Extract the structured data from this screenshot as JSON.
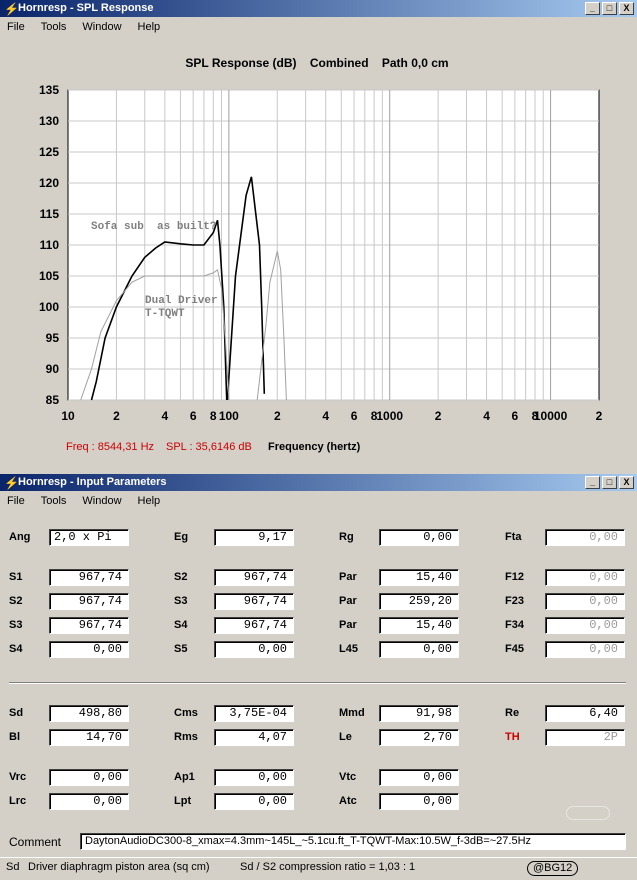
{
  "spl_window": {
    "title": "Hornresp - SPL Response",
    "menu": [
      "File",
      "Tools",
      "Window",
      "Help"
    ],
    "buttons": {
      "minimize": "_",
      "maximize": "□",
      "close": "X"
    }
  },
  "chart_data": {
    "type": "line",
    "title": "SPL Response (dB)    Combined    Path 0,0 cm",
    "xlabel": "Frequency (hertz)",
    "x_scale": "log",
    "xlim": [
      10,
      20000
    ],
    "ylim": [
      85,
      135
    ],
    "y_ticks": [
      135,
      130,
      125,
      120,
      115,
      110,
      105,
      100,
      95,
      90,
      85
    ],
    "x_tick_labels": [
      {
        "f": 10,
        "t": "10"
      },
      {
        "f": 20,
        "t": "2"
      },
      {
        "f": 40,
        "t": "4"
      },
      {
        "f": 60,
        "t": "6"
      },
      {
        "f": 80,
        "t": "8"
      },
      {
        "f": 100,
        "t": "100"
      },
      {
        "f": 200,
        "t": "2"
      },
      {
        "f": 400,
        "t": "4"
      },
      {
        "f": 600,
        "t": "6"
      },
      {
        "f": 800,
        "t": "8"
      },
      {
        "f": 1000,
        "t": "1000"
      },
      {
        "f": 2000,
        "t": "2"
      },
      {
        "f": 4000,
        "t": "4"
      },
      {
        "f": 6000,
        "t": "6"
      },
      {
        "f": 8000,
        "t": "8"
      },
      {
        "f": 10000,
        "t": "10000"
      },
      {
        "f": 20000,
        "t": "2"
      }
    ],
    "grid": true,
    "annotations": [
      "Sofa sub  as built?",
      "Dual Driver",
      "T-TQWT"
    ],
    "series": [
      {
        "color": "#000000",
        "points": [
          [
            14,
            85
          ],
          [
            15,
            88
          ],
          [
            17,
            95
          ],
          [
            20,
            100
          ],
          [
            25,
            105
          ],
          [
            30,
            108
          ],
          [
            35,
            109.5
          ],
          [
            40,
            110.5
          ],
          [
            50,
            110.2
          ],
          [
            60,
            110
          ],
          [
            70,
            110
          ],
          [
            80,
            112
          ],
          [
            85,
            114
          ],
          [
            88,
            110
          ],
          [
            93,
            100
          ],
          [
            97,
            85
          ]
        ]
      },
      {
        "color": "#000000",
        "points": [
          [
            98,
            85
          ],
          [
            110,
            105
          ],
          [
            128,
            118
          ],
          [
            138,
            121
          ],
          [
            147,
            115
          ],
          [
            155,
            110
          ],
          [
            160,
            100
          ],
          [
            166,
            86
          ]
        ]
      },
      {
        "color": "#a0a0a0",
        "points": [
          [
            12,
            85
          ],
          [
            14,
            90
          ],
          [
            16,
            96
          ],
          [
            20,
            101
          ],
          [
            25,
            104
          ],
          [
            30,
            105
          ],
          [
            40,
            105
          ],
          [
            50,
            105
          ],
          [
            60,
            105
          ],
          [
            70,
            105
          ],
          [
            80,
            105.5
          ],
          [
            85,
            106
          ],
          [
            90,
            103
          ],
          [
            95,
            95
          ],
          [
            100,
            85
          ]
        ]
      },
      {
        "color": "#a0a0a0",
        "points": [
          [
            150,
            85
          ],
          [
            170,
            97
          ],
          [
            180,
            104
          ],
          [
            200,
            109
          ],
          [
            210,
            106
          ],
          [
            220,
            95
          ],
          [
            228,
            85
          ]
        ]
      }
    ]
  },
  "readout": {
    "freq": "Freq : 8544,31 Hz",
    "spl": "SPL : 35,6146 dB",
    "axis_label": "Frequency (hertz)"
  },
  "input_window": {
    "title": "Hornresp - Input Parameters",
    "menu": [
      "File",
      "Tools",
      "Window",
      "Help"
    ],
    "buttons": {
      "minimize": "_",
      "maximize": "□",
      "close": "X"
    },
    "params": {
      "ang": {
        "label": "Ang",
        "value": "2,0 x Pi"
      },
      "eg": {
        "label": "Eg",
        "value": "9,17"
      },
      "rg": {
        "label": "Rg",
        "value": "0,00"
      },
      "fta": {
        "label": "Fta",
        "value": "0,00"
      },
      "s1": {
        "label": "S1",
        "value": "967,74"
      },
      "s2a": {
        "label": "S2",
        "value": "967,74"
      },
      "par1": {
        "label": "Par",
        "value": "15,40"
      },
      "f12": {
        "label": "F12",
        "value": "0,00"
      },
      "s2b": {
        "label": "S2",
        "value": "967,74"
      },
      "s3a": {
        "label": "S3",
        "value": "967,74"
      },
      "par2": {
        "label": "Par",
        "value": "259,20"
      },
      "f23": {
        "label": "F23",
        "value": "0,00"
      },
      "s3b": {
        "label": "S3",
        "value": "967,74"
      },
      "s4a": {
        "label": "S4",
        "value": "967,74"
      },
      "par3": {
        "label": "Par",
        "value": "15,40"
      },
      "f34": {
        "label": "F34",
        "value": "0,00"
      },
      "s4b": {
        "label": "S4",
        "value": "0,00"
      },
      "s5": {
        "label": "S5",
        "value": "0,00"
      },
      "l45": {
        "label": "L45",
        "value": "0,00"
      },
      "f45": {
        "label": "F45",
        "value": "0,00"
      },
      "sd": {
        "label": "Sd",
        "value": "498,80"
      },
      "cms": {
        "label": "Cms",
        "value": "3,75E-04"
      },
      "mmd": {
        "label": "Mmd",
        "value": "91,98"
      },
      "re": {
        "label": "Re",
        "value": "6,40"
      },
      "bl": {
        "label": "Bl",
        "value": "14,70"
      },
      "rms": {
        "label": "Rms",
        "value": "4,07"
      },
      "le": {
        "label": "Le",
        "value": "2,70"
      },
      "th": {
        "label": "TH",
        "value": "2P"
      },
      "vrc": {
        "label": "Vrc",
        "value": "0,00"
      },
      "ap1": {
        "label": "Ap1",
        "value": "0,00"
      },
      "vtc": {
        "label": "Vtc",
        "value": "0,00"
      },
      "lrc": {
        "label": "Lrc",
        "value": "0,00"
      },
      "lpt": {
        "label": "Lpt",
        "value": "0,00"
      },
      "atc": {
        "label": "Atc",
        "value": "0,00"
      }
    },
    "comment_label": "Comment",
    "comment": "DaytonAudioDC300-8_xmax=4.3mm~145L_~5.1cu.ft_T-TQWT-Max:10.5W_f-3dB=~27.5Hz"
  },
  "status": {
    "field": "Sd",
    "description": "Driver diaphragm piston area  (sq cm)",
    "ratio": "Sd / S2 compression ratio = 1,03 : 1",
    "badge": "@BG12"
  },
  "colors": {
    "titlebar_start": "#0a246a",
    "titlebar_end": "#a6caf0",
    "readout_red": "#cc0000",
    "th_red": "#cc0000",
    "face": "#d4d0c8"
  }
}
